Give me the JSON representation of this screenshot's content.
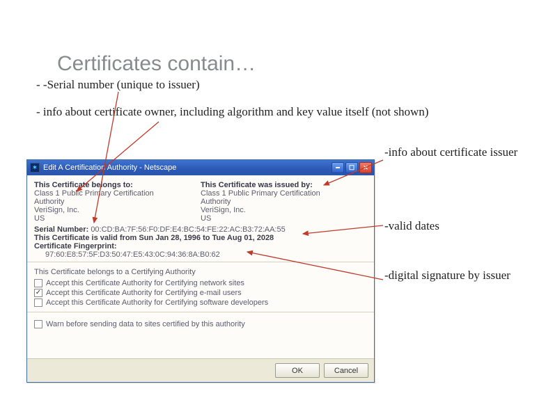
{
  "title": "Certificates contain…",
  "bullets": {
    "b1": "- -Serial number (unique to issuer)",
    "b2": "  - info about certificate owner, including algorithm and key value itself (not shown)"
  },
  "labels": {
    "issuer": "-info about certificate issuer",
    "valid": "-valid dates",
    "sig": "-digital signature by issuer"
  },
  "dialog": {
    "title": "Edit A Certification Authority - Netscape",
    "belongs_to_header": "This Certificate belongs to:",
    "issued_by_header": "This Certificate was issued by:",
    "cert_name_1": "Class 1 Public Primary Certification",
    "cert_name_2": "Authority",
    "org": "VeriSign, Inc.",
    "country": "US",
    "serial_label": "Serial Number:",
    "serial_value": "00:CD:BA:7F:56:F0:DF:E4:BC:54:FE:22:AC:B3:72:AA:55",
    "valid_text": "This Certificate is valid from Sun Jan 28, 1996 to Tue Aug 01, 2028",
    "fingerprint_label": "Certificate Fingerprint:",
    "fingerprint_value": "97:60:E8:57:5F:D3:50:47:E5:43:0C:94:36:8A:B0:62",
    "ca_text": "This Certificate belongs to a Certifying Authority",
    "chk1": "Accept this Certificate Authority for Certifying network sites",
    "chk2": "Accept this Certificate Authority for Certifying e-mail users",
    "chk3": "Accept this Certificate Authority for Certifying software developers",
    "warn": "Warn before sending data to sites certified by this authority",
    "ok": "OK",
    "cancel": "Cancel"
  }
}
